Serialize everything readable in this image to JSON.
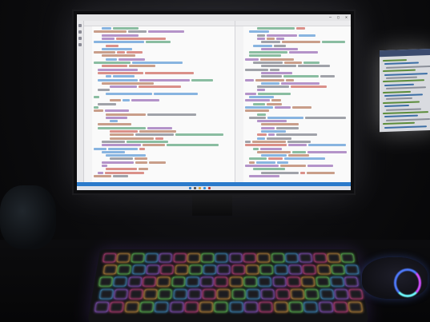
{
  "scene": {
    "description_type": "photo",
    "main_monitor": {
      "editor": "code-editor",
      "theme": "light",
      "accent_color": "#2a7acb"
    },
    "keyboard_lighting": [
      "#ff4fa0",
      "#ffb347",
      "#7cff6b",
      "#4fb8ff",
      "#b46bff"
    ],
    "mouse_lighting": [
      "#4f7bff",
      "#d34fff",
      "#6ffcff"
    ]
  }
}
